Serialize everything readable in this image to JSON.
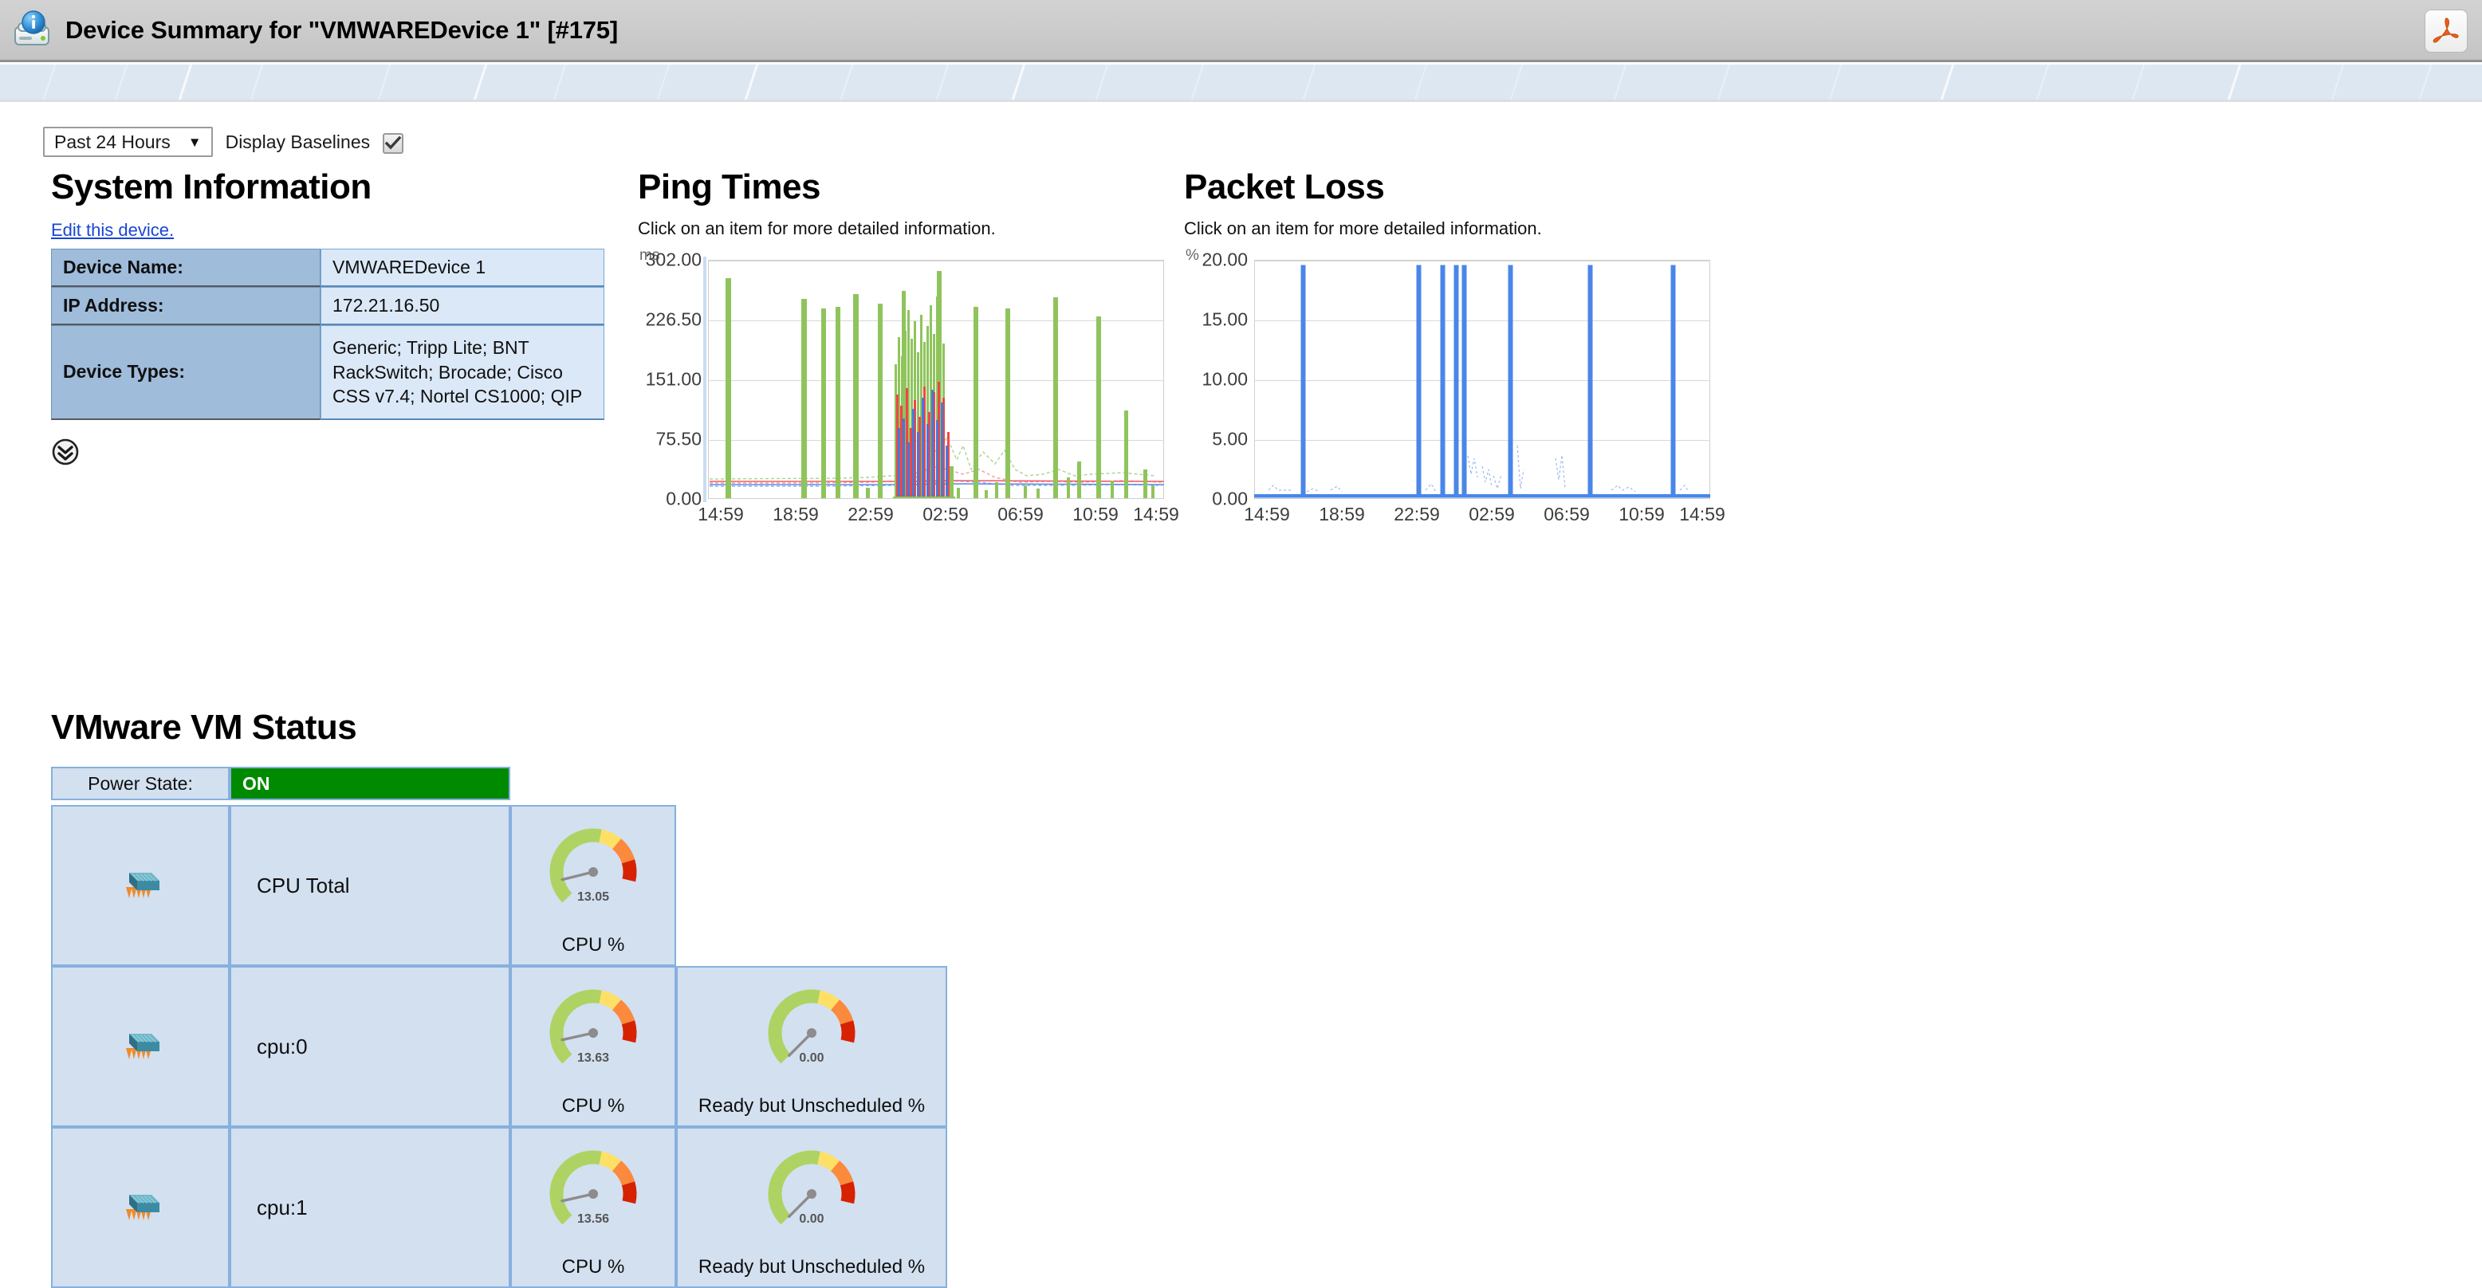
{
  "window": {
    "title": "Device Summary for \"VMWAREDevice 1\" [#175]",
    "device_icon": "device-info-icon",
    "export_icon": "pdf-export-icon"
  },
  "toolbar": {
    "time_range": "Past 24 Hours",
    "time_range_caret": "▼",
    "baselines_label": "Display Baselines",
    "baselines_checked": true
  },
  "system_information": {
    "heading": "System Information",
    "edit_link": "Edit this device.",
    "rows": [
      {
        "key": "Device Name:",
        "value": "VMWAREDevice 1"
      },
      {
        "key": "IP Address:",
        "value": "172.21.16.50"
      },
      {
        "key": "Device Types:",
        "value": "Generic; Tripp Lite; BNT RackSwitch; Brocade; Cisco CSS v7.4; Nortel CS1000; QIP"
      }
    ],
    "expand_icon": "double-chevron-down-icon"
  },
  "vmware": {
    "heading": "VMware VM Status",
    "power_state_label": "Power State:",
    "power_state_value": "ON",
    "power_state_color": "#008a00",
    "rows": [
      {
        "icon": "cpu-chip-icon",
        "name": "CPU Total",
        "gauges": [
          {
            "value": "13.05",
            "numeric": 13.05,
            "label": "CPU %"
          }
        ]
      },
      {
        "icon": "cpu-chip-icon",
        "name": "cpu:0",
        "gauges": [
          {
            "value": "13.63",
            "numeric": 13.63,
            "label": "CPU %"
          },
          {
            "value": "0.00",
            "numeric": 0.0,
            "label": "Ready but Unscheduled %"
          }
        ]
      },
      {
        "icon": "cpu-chip-icon",
        "name": "cpu:1",
        "gauges": [
          {
            "value": "13.56",
            "numeric": 13.56,
            "label": "CPU %"
          },
          {
            "value": "0.00",
            "numeric": 0.0,
            "label": "Ready but Unscheduled %"
          }
        ]
      }
    ],
    "gauge_colors": {
      "green": "#aed363",
      "yellow": "#ffe066",
      "orange": "#fb8a3c",
      "red": "#d62200",
      "needle": "#8c8c8c"
    }
  },
  "chart_data": [
    {
      "id": "ping-times",
      "type": "line",
      "title": "Ping Times",
      "subtitle": "Click on an item for more detailed information.",
      "unit": "ms",
      "ylabel": "ms",
      "xlabel": "",
      "ylim": [
        0,
        302.0
      ],
      "yticks": [
        "0.00",
        "75.50",
        "151.00",
        "226.50",
        "302.00"
      ],
      "ytick_values": [
        0.0,
        75.5,
        151.0,
        226.5,
        302.0
      ],
      "xticks": [
        "14:59",
        "18:59",
        "22:59",
        "02:59",
        "06:59",
        "10:59",
        "14:59"
      ],
      "grid": true,
      "legend": "none",
      "series": [
        {
          "name": "Ping (green)",
          "color": "#8fc45c"
        },
        {
          "name": "Ping (red)",
          "color": "#f23f43"
        },
        {
          "name": "Ping (blue)",
          "color": "#3f77e0"
        },
        {
          "name": "Baseline (green dashed)",
          "color": "#9dcd7a"
        },
        {
          "name": "Baseline (red dashed)",
          "color": "#f08a90"
        },
        {
          "name": "Baseline (blue dashed)",
          "color": "#7fa3e8"
        }
      ],
      "spikes_ms": [
        278,
        252,
        240,
        246,
        258,
        252,
        295,
        242,
        244,
        254,
        228,
        112,
        48
      ],
      "baseline_ms": 20
    },
    {
      "id": "packet-loss",
      "type": "line",
      "title": "Packet Loss",
      "subtitle": "Click on an item for more detailed information.",
      "unit": "%",
      "ylabel": "%",
      "xlabel": "",
      "ylim": [
        0,
        20.0
      ],
      "yticks": [
        "0.00",
        "5.00",
        "10.00",
        "15.00",
        "20.00"
      ],
      "ytick_values": [
        0.0,
        5.0,
        10.0,
        15.0,
        20.0
      ],
      "xticks": [
        "14:59",
        "18:59",
        "22:59",
        "02:59",
        "06:59",
        "10:59",
        "14:59"
      ],
      "grid": true,
      "legend": "none",
      "series": [
        {
          "name": "Packet Loss",
          "color": "#4a86e8"
        }
      ],
      "spikes_pct": [
        19.5,
        19.5,
        19.5,
        19.5,
        19.5,
        19.5,
        19.5
      ],
      "baseline_pct": 0.2
    }
  ]
}
